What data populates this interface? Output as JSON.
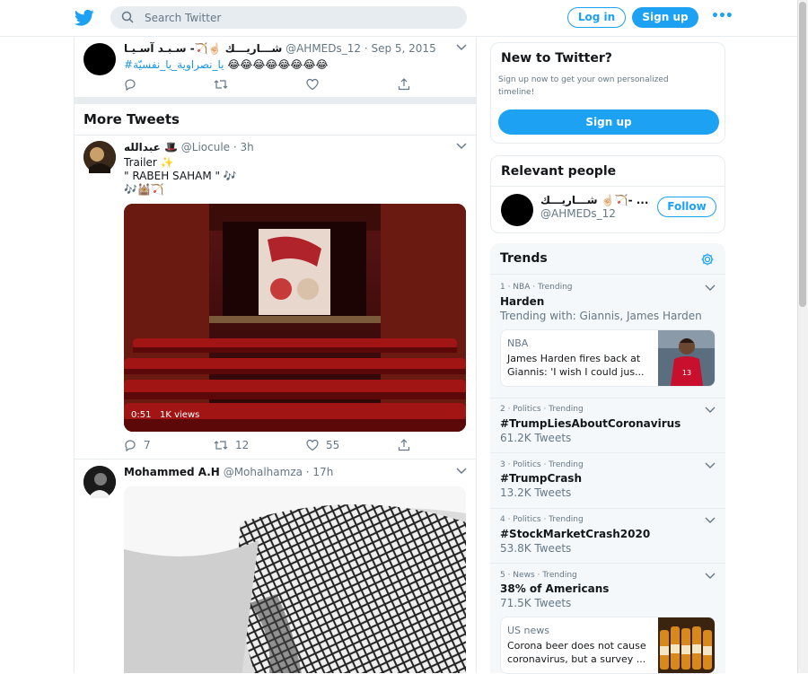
{
  "search": {
    "placeholder": "Search Twitter"
  },
  "header": {
    "login_label": "Log in",
    "signup_label": "Sign up",
    "more_label": "•••"
  },
  "tweet1": {
    "name": "شـــاريـــك ☝🏻🏹- سـبـد آسـيـا",
    "handle": "@AHMEDs_12 · Sep 5, 2015",
    "text_emoji": "😂😂😂😂😂😂😂😂",
    "text_hashtag": "#يا_نصراوية_يا_نفسيّة"
  },
  "more_tweets_title": "More Tweets",
  "tweet2": {
    "name": "عبدالله 🎩",
    "handle": "@Liocule · 3h",
    "line1": "Trailer ✨",
    "line2": "\" RABEH SAHAM \" 🎶",
    "line3": "🎶🕍🏹",
    "media_duration": "0:51",
    "media_views": "1K views",
    "replies": "7",
    "retweets": "12",
    "likes": "55"
  },
  "tweet3": {
    "name": "Mohammed A.H",
    "handle": "@Mohalhamza · 17h"
  },
  "sidebar": {
    "new_title": "New to Twitter?",
    "new_sub": "Sign up now to get your own personalized timeline!",
    "new_btn": "Sign up",
    "relevant_title": "Relevant people",
    "person_name": "شـــاريـــك ☝🏻🏹- ...",
    "person_handle": "@AHMEDs_12",
    "follow_label": "Follow"
  },
  "trends": {
    "title": "Trends",
    "items": [
      {
        "meta": "1 · NBA · Trending",
        "name": "Harden",
        "sub": "Trending with: Giannis, James Harden",
        "card_src": "NBA",
        "card_text": "James Harden fires back at Giannis: 'I wish I could jus..."
      },
      {
        "meta": "2 · Politics · Trending",
        "name": "#TrumpLiesAboutCoronavirus",
        "sub": "61.2K Tweets"
      },
      {
        "meta": "3 · Politics · Trending",
        "name": "#TrumpCrash",
        "sub": "13.2K Tweets"
      },
      {
        "meta": "4 · Politics · Trending",
        "name": "#StockMarketCrash2020",
        "sub": "53.8K Tweets"
      },
      {
        "meta": "5 · News · Trending",
        "name": "38% of Americans",
        "sub": "71.5K Tweets",
        "card_src": "US news",
        "card_text": "Corona beer does not cause coronavirus, but a survey ..."
      }
    ]
  },
  "colors": {
    "accent": "#1da1f2",
    "text": "#14171a",
    "muted": "#657786",
    "border": "#e6ecf0"
  }
}
